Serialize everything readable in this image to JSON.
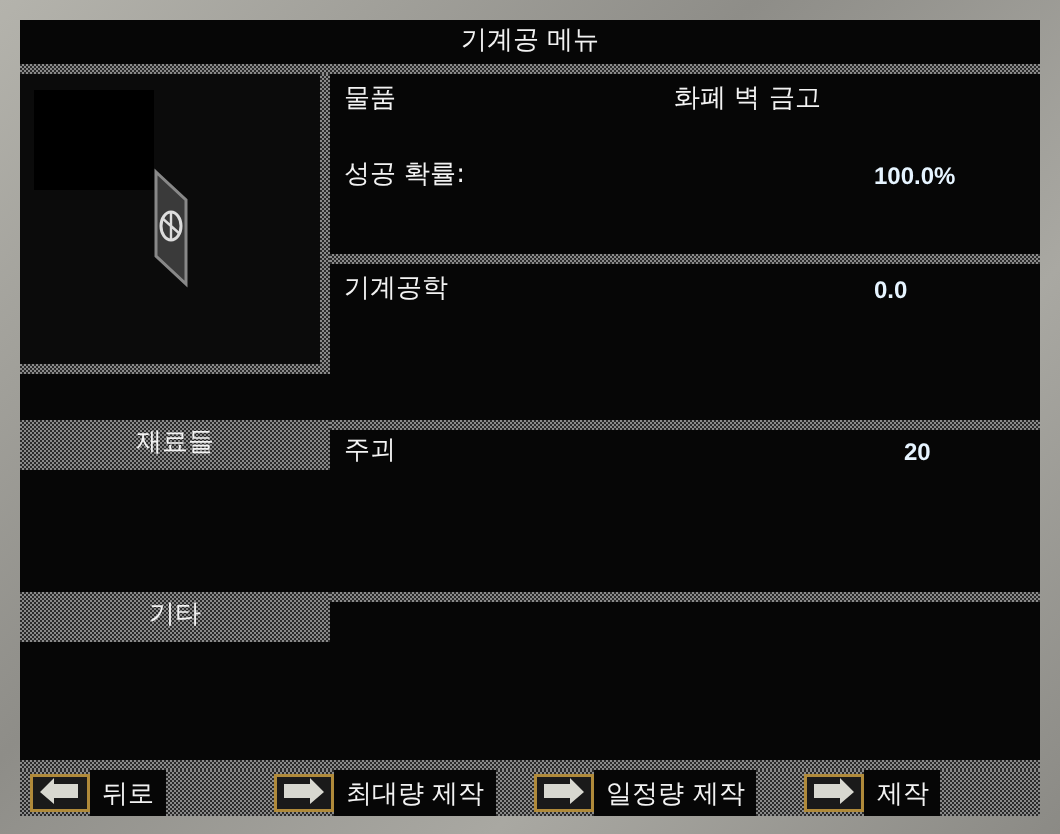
{
  "window": {
    "title": "기계공 메뉴"
  },
  "item": {
    "label": "물품",
    "value": "화폐 벽 금고"
  },
  "success": {
    "label": "성공 확률:",
    "value": "100.0%"
  },
  "skill": {
    "label": "기계공학",
    "value": "0.0"
  },
  "sections": [
    {
      "header": "재료들",
      "rows": [
        {
          "name": "주괴",
          "amount": "20"
        }
      ]
    },
    {
      "header": "기타"
    }
  ],
  "buttons": [
    {
      "label": "뒤로",
      "kind": "back"
    },
    {
      "label": "최대량 제작",
      "kind": "forward"
    },
    {
      "label": "일정량 제작",
      "kind": "forward"
    },
    {
      "label": "제작",
      "kind": "forward"
    }
  ]
}
